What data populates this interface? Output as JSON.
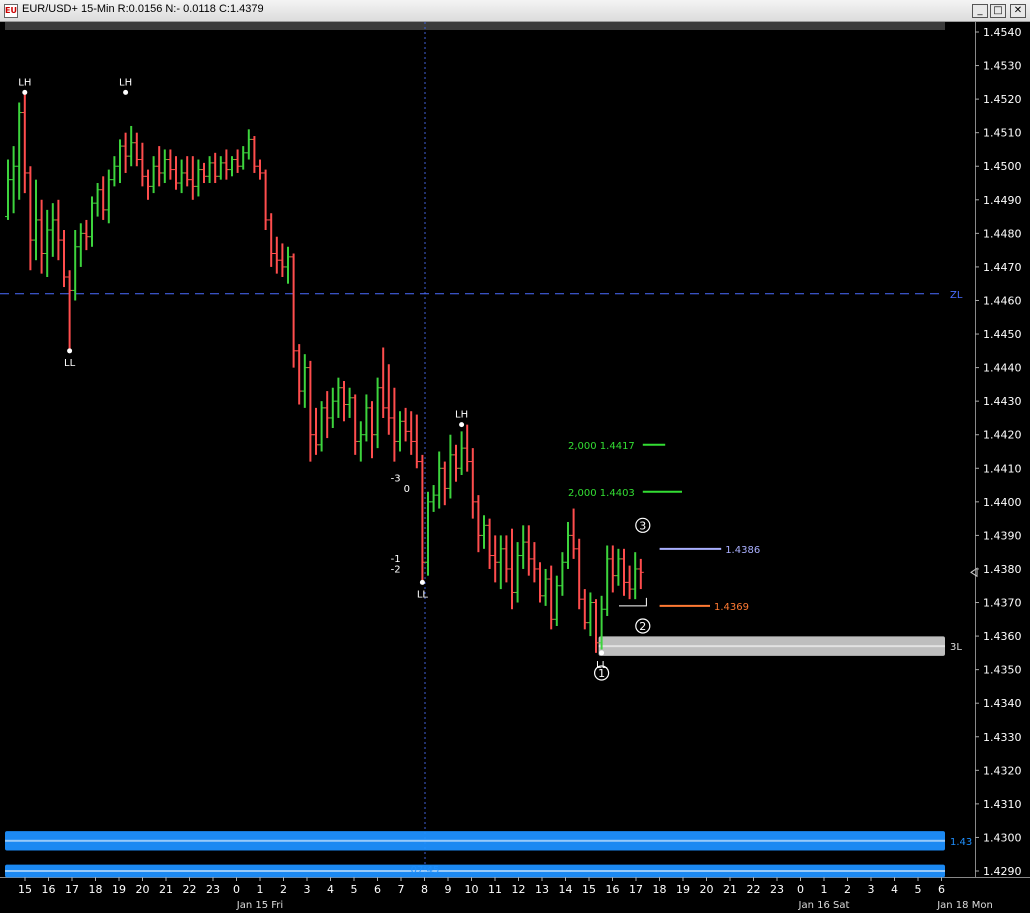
{
  "window": {
    "title": "EUR/USD+ 15-Min R:0.0156 N:- 0.0118 C:1.4379",
    "app_icon": "chart-window-icon",
    "controls": [
      {
        "name": "minimize-button",
        "icon": "minimize-icon",
        "glyph": "_"
      },
      {
        "name": "maximize-button",
        "icon": "maximize-icon",
        "glyph": "□"
      },
      {
        "name": "close-button",
        "icon": "close-icon",
        "glyph": "✕"
      }
    ]
  },
  "colors": {
    "background": "#000000",
    "up": "#3dd43d",
    "down": "#ff4d4d",
    "zl_line": "#4a6cff",
    "bar_blue": "#1e90ff",
    "target_green": "#33dd33",
    "target_blue": "#aab0ff",
    "target_orange": "#ff7a33",
    "axis_text": "#ffffff"
  },
  "chart_data": {
    "type": "ohlc",
    "symbol": "EUR/USD+",
    "interval": "15-Min",
    "ylim": [
      1.4287,
      1.4547
    ],
    "y_ticks": [
      "1.4540",
      "1.4530",
      "1.4520",
      "1.4510",
      "1.4500",
      "1.4490",
      "1.4480",
      "1.4470",
      "1.4460",
      "1.4450",
      "1.4440",
      "1.4430",
      "1.4420",
      "1.4410",
      "1.4400",
      "1.4390",
      "1.4380",
      "1.4370",
      "1.4360",
      "1.4350",
      "1.4340",
      "1.4330",
      "1.4320",
      "1.4310",
      "1.4300",
      "1.4290"
    ],
    "x_ticks": [
      "15",
      "16",
      "17",
      "18",
      "19",
      "20",
      "21",
      "22",
      "23",
      "0",
      "1",
      "2",
      "3",
      "4",
      "5",
      "6",
      "7",
      "8",
      "9",
      "10",
      "11",
      "12",
      "13",
      "14",
      "15",
      "16",
      "17",
      "18",
      "19",
      "20",
      "21",
      "22",
      "23",
      "0",
      "1",
      "2",
      "3",
      "4",
      "5",
      "6"
    ],
    "date_labels": [
      {
        "text": "Jan 15 Fri",
        "tick_index": 10
      },
      {
        "text": "Jan 16 Sat",
        "tick_index": 34
      },
      {
        "text": "Jan 18 Mon",
        "tick_index": 40
      }
    ],
    "bars": [
      {
        "open": 1.4485,
        "high": 1.4502,
        "low": 1.4484,
        "close": 1.4496
      },
      {
        "open": 1.4496,
        "high": 1.4506,
        "low": 1.4486,
        "close": 1.45
      },
      {
        "open": 1.45,
        "high": 1.4519,
        "low": 1.449,
        "close": 1.4516
      },
      {
        "open": 1.4516,
        "high": 1.4522,
        "low": 1.4492,
        "close": 1.4498
      },
      {
        "open": 1.4498,
        "high": 1.45,
        "low": 1.4469,
        "close": 1.4478
      },
      {
        "open": 1.4478,
        "high": 1.4496,
        "low": 1.4472,
        "close": 1.4484
      },
      {
        "open": 1.4484,
        "high": 1.449,
        "low": 1.4468,
        "close": 1.4474
      },
      {
        "open": 1.4474,
        "high": 1.4487,
        "low": 1.4467,
        "close": 1.4481
      },
      {
        "open": 1.4481,
        "high": 1.4489,
        "low": 1.4473,
        "close": 1.4484
      },
      {
        "open": 1.4484,
        "high": 1.449,
        "low": 1.4472,
        "close": 1.4478
      },
      {
        "open": 1.4478,
        "high": 1.4481,
        "low": 1.4464,
        "close": 1.4467
      },
      {
        "open": 1.4467,
        "high": 1.4469,
        "low": 1.4445,
        "close": 1.4463
      },
      {
        "open": 1.4463,
        "high": 1.4481,
        "low": 1.446,
        "close": 1.4476
      },
      {
        "open": 1.4476,
        "high": 1.4483,
        "low": 1.447,
        "close": 1.448
      },
      {
        "open": 1.448,
        "high": 1.4484,
        "low": 1.4475,
        "close": 1.4479
      },
      {
        "open": 1.4479,
        "high": 1.4491,
        "low": 1.4476,
        "close": 1.4489
      },
      {
        "open": 1.4489,
        "high": 1.4495,
        "low": 1.4485,
        "close": 1.4493
      },
      {
        "open": 1.4493,
        "high": 1.4497,
        "low": 1.4484,
        "close": 1.4487
      },
      {
        "open": 1.4487,
        "high": 1.4499,
        "low": 1.4483,
        "close": 1.4496
      },
      {
        "open": 1.4496,
        "high": 1.4503,
        "low": 1.4494,
        "close": 1.45
      },
      {
        "open": 1.45,
        "high": 1.4508,
        "low": 1.4495,
        "close": 1.4506
      },
      {
        "open": 1.4506,
        "high": 1.451,
        "low": 1.4498,
        "close": 1.4503
      },
      {
        "open": 1.4503,
        "high": 1.4512,
        "low": 1.45,
        "close": 1.4507
      },
      {
        "open": 1.4507,
        "high": 1.451,
        "low": 1.45,
        "close": 1.4502
      },
      {
        "open": 1.4502,
        "high": 1.4507,
        "low": 1.4494,
        "close": 1.4497
      },
      {
        "open": 1.4497,
        "high": 1.4499,
        "low": 1.449,
        "close": 1.4494
      },
      {
        "open": 1.4494,
        "high": 1.4503,
        "low": 1.4492,
        "close": 1.45
      },
      {
        "open": 1.45,
        "high": 1.4506,
        "low": 1.4494,
        "close": 1.4498
      },
      {
        "open": 1.4498,
        "high": 1.4505,
        "low": 1.4495,
        "close": 1.4502
      },
      {
        "open": 1.4502,
        "high": 1.4505,
        "low": 1.4496,
        "close": 1.4499
      },
      {
        "open": 1.4499,
        "high": 1.4503,
        "low": 1.4493,
        "close": 1.4495
      },
      {
        "open": 1.4495,
        "high": 1.4502,
        "low": 1.4492,
        "close": 1.4498
      },
      {
        "open": 1.4498,
        "high": 1.4503,
        "low": 1.4494,
        "close": 1.4496
      },
      {
        "open": 1.4496,
        "high": 1.4503,
        "low": 1.449,
        "close": 1.4494
      },
      {
        "open": 1.4494,
        "high": 1.4502,
        "low": 1.4491,
        "close": 1.4499
      },
      {
        "open": 1.4499,
        "high": 1.4501,
        "low": 1.4495,
        "close": 1.4497
      },
      {
        "open": 1.4497,
        "high": 1.4503,
        "low": 1.4495,
        "close": 1.4501
      },
      {
        "open": 1.4501,
        "high": 1.4504,
        "low": 1.4495,
        "close": 1.4497
      },
      {
        "open": 1.4497,
        "high": 1.4503,
        "low": 1.4496,
        "close": 1.4501
      },
      {
        "open": 1.4501,
        "high": 1.4505,
        "low": 1.4496,
        "close": 1.4499
      },
      {
        "open": 1.4499,
        "high": 1.4503,
        "low": 1.4497,
        "close": 1.4502
      },
      {
        "open": 1.4502,
        "high": 1.4505,
        "low": 1.4498,
        "close": 1.45
      },
      {
        "open": 1.45,
        "high": 1.4506,
        "low": 1.4499,
        "close": 1.4504
      },
      {
        "open": 1.4504,
        "high": 1.4511,
        "low": 1.4502,
        "close": 1.4508
      },
      {
        "open": 1.4508,
        "high": 1.4509,
        "low": 1.4498,
        "close": 1.45
      },
      {
        "open": 1.45,
        "high": 1.4502,
        "low": 1.4496,
        "close": 1.4498
      },
      {
        "open": 1.4498,
        "high": 1.4499,
        "low": 1.4481,
        "close": 1.4484
      },
      {
        "open": 1.4484,
        "high": 1.4486,
        "low": 1.447,
        "close": 1.4474
      },
      {
        "open": 1.4474,
        "high": 1.4479,
        "low": 1.4468,
        "close": 1.4472
      },
      {
        "open": 1.4472,
        "high": 1.4477,
        "low": 1.4467,
        "close": 1.447
      },
      {
        "open": 1.447,
        "high": 1.4476,
        "low": 1.4465,
        "close": 1.4473
      },
      {
        "open": 1.4473,
        "high": 1.4474,
        "low": 1.444,
        "close": 1.4445
      },
      {
        "open": 1.4445,
        "high": 1.4447,
        "low": 1.4429,
        "close": 1.4433
      },
      {
        "open": 1.4433,
        "high": 1.4444,
        "low": 1.4428,
        "close": 1.444
      },
      {
        "open": 1.444,
        "high": 1.4442,
        "low": 1.4412,
        "close": 1.442
      },
      {
        "open": 1.442,
        "high": 1.4428,
        "low": 1.4414,
        "close": 1.4417
      },
      {
        "open": 1.4417,
        "high": 1.443,
        "low": 1.4415,
        "close": 1.4428
      },
      {
        "open": 1.4428,
        "high": 1.4433,
        "low": 1.4419,
        "close": 1.4425
      },
      {
        "open": 1.4425,
        "high": 1.4434,
        "low": 1.4422,
        "close": 1.443
      },
      {
        "open": 1.443,
        "high": 1.4437,
        "low": 1.4425,
        "close": 1.4434
      },
      {
        "open": 1.4434,
        "high": 1.4436,
        "low": 1.4424,
        "close": 1.4429
      },
      {
        "open": 1.4429,
        "high": 1.4434,
        "low": 1.4425,
        "close": 1.4431
      },
      {
        "open": 1.4431,
        "high": 1.4432,
        "low": 1.4414,
        "close": 1.4418
      },
      {
        "open": 1.4418,
        "high": 1.4424,
        "low": 1.4412,
        "close": 1.442
      },
      {
        "open": 1.442,
        "high": 1.4432,
        "low": 1.4418,
        "close": 1.4428
      },
      {
        "open": 1.4428,
        "high": 1.443,
        "low": 1.4413,
        "close": 1.442
      },
      {
        "open": 1.442,
        "high": 1.4437,
        "low": 1.4416,
        "close": 1.4434
      },
      {
        "open": 1.4434,
        "high": 1.4446,
        "low": 1.4425,
        "close": 1.4428
      },
      {
        "open": 1.4428,
        "high": 1.4441,
        "low": 1.442,
        "close": 1.4425
      },
      {
        "open": 1.4425,
        "high": 1.4434,
        "low": 1.4412,
        "close": 1.4418
      },
      {
        "open": 1.4418,
        "high": 1.4427,
        "low": 1.4415,
        "close": 1.4424
      },
      {
        "open": 1.4424,
        "high": 1.4428,
        "low": 1.4418,
        "close": 1.4421
      },
      {
        "open": 1.4421,
        "high": 1.4427,
        "low": 1.4414,
        "close": 1.4418
      },
      {
        "open": 1.4418,
        "high": 1.4426,
        "low": 1.441,
        "close": 1.4412
      },
      {
        "open": 1.4412,
        "high": 1.4414,
        "low": 1.4376,
        "close": 1.4382
      },
      {
        "open": 1.4382,
        "high": 1.4403,
        "low": 1.4378,
        "close": 1.44
      },
      {
        "open": 1.44,
        "high": 1.4405,
        "low": 1.4397,
        "close": 1.4402
      },
      {
        "open": 1.4402,
        "high": 1.4415,
        "low": 1.4398,
        "close": 1.441
      },
      {
        "open": 1.441,
        "high": 1.4412,
        "low": 1.4399,
        "close": 1.4404
      },
      {
        "open": 1.4404,
        "high": 1.442,
        "low": 1.4401,
        "close": 1.4414
      },
      {
        "open": 1.4414,
        "high": 1.4417,
        "low": 1.4406,
        "close": 1.441
      },
      {
        "open": 1.441,
        "high": 1.4421,
        "low": 1.4408,
        "close": 1.4416
      },
      {
        "open": 1.4416,
        "high": 1.4423,
        "low": 1.4409,
        "close": 1.4412
      },
      {
        "open": 1.4412,
        "high": 1.4416,
        "low": 1.4395,
        "close": 1.44
      },
      {
        "open": 1.44,
        "high": 1.4402,
        "low": 1.4385,
        "close": 1.439
      },
      {
        "open": 1.439,
        "high": 1.4396,
        "low": 1.4386,
        "close": 1.4393
      },
      {
        "open": 1.4393,
        "high": 1.4395,
        "low": 1.438,
        "close": 1.4384
      },
      {
        "open": 1.4384,
        "high": 1.439,
        "low": 1.4376,
        "close": 1.4382
      },
      {
        "open": 1.4382,
        "high": 1.439,
        "low": 1.4374,
        "close": 1.4386
      },
      {
        "open": 1.4386,
        "high": 1.439,
        "low": 1.4376,
        "close": 1.438
      },
      {
        "open": 1.438,
        "high": 1.4392,
        "low": 1.4368,
        "close": 1.4373
      },
      {
        "open": 1.4373,
        "high": 1.4388,
        "low": 1.437,
        "close": 1.4384
      },
      {
        "open": 1.4384,
        "high": 1.4393,
        "low": 1.438,
        "close": 1.4388
      },
      {
        "open": 1.4388,
        "high": 1.4393,
        "low": 1.4378,
        "close": 1.4383
      },
      {
        "open": 1.4383,
        "high": 1.4388,
        "low": 1.4376,
        "close": 1.438
      },
      {
        "open": 1.438,
        "high": 1.4382,
        "low": 1.437,
        "close": 1.4372
      },
      {
        "open": 1.4372,
        "high": 1.438,
        "low": 1.4369,
        "close": 1.4377
      },
      {
        "open": 1.4377,
        "high": 1.4381,
        "low": 1.4362,
        "close": 1.4365
      },
      {
        "open": 1.4365,
        "high": 1.4378,
        "low": 1.4363,
        "close": 1.4375
      },
      {
        "open": 1.4375,
        "high": 1.4385,
        "low": 1.4372,
        "close": 1.4382
      },
      {
        "open": 1.4382,
        "high": 1.4394,
        "low": 1.438,
        "close": 1.439
      },
      {
        "open": 1.439,
        "high": 1.4398,
        "low": 1.4383,
        "close": 1.4386
      },
      {
        "open": 1.4386,
        "high": 1.4389,
        "low": 1.4368,
        "close": 1.4371
      },
      {
        "open": 1.4371,
        "high": 1.4374,
        "low": 1.4362,
        "close": 1.4364
      },
      {
        "open": 1.4364,
        "high": 1.4373,
        "low": 1.436,
        "close": 1.437
      },
      {
        "open": 1.437,
        "high": 1.4371,
        "low": 1.4355,
        "close": 1.4358
      },
      {
        "open": 1.4358,
        "high": 1.4372,
        "low": 1.4356,
        "close": 1.4368
      },
      {
        "open": 1.4368,
        "high": 1.4387,
        "low": 1.4366,
        "close": 1.4383
      },
      {
        "open": 1.4383,
        "high": 1.4387,
        "low": 1.4373,
        "close": 1.4378
      },
      {
        "open": 1.4378,
        "high": 1.4386,
        "low": 1.4375,
        "close": 1.4383
      },
      {
        "open": 1.4383,
        "high": 1.4386,
        "low": 1.4372,
        "close": 1.4376
      },
      {
        "open": 1.4376,
        "high": 1.4381,
        "low": 1.4371,
        "close": 1.4374
      },
      {
        "open": 1.4374,
        "high": 1.4385,
        "low": 1.4371,
        "close": 1.438
      },
      {
        "open": 1.438,
        "high": 1.4383,
        "low": 1.4374,
        "close": 1.4379
      }
    ],
    "swing_labels": [
      {
        "text": "LH",
        "bar": 3,
        "price": 1.4522,
        "side": "above"
      },
      {
        "text": "LH",
        "bar": 21,
        "price": 1.4522,
        "side": "above"
      },
      {
        "text": "LL",
        "bar": 11,
        "price": 1.4445,
        "side": "below"
      },
      {
        "text": "LH",
        "bar": 81,
        "price": 1.4423,
        "side": "above"
      },
      {
        "text": "LL",
        "bar": 74,
        "price": 1.4376,
        "side": "below"
      },
      {
        "text": "LL",
        "bar": 106,
        "price": 1.4355,
        "side": "below"
      }
    ],
    "wave_labels": [
      {
        "text": "1",
        "bar": 106,
        "price": 1.4349
      },
      {
        "text": "2",
        "bar": 113,
        "price": 1.4363
      },
      {
        "text": "3",
        "bar": 113,
        "price": 1.4393
      }
    ],
    "small_labels": [
      {
        "text": "-3",
        "bar": 71,
        "price": 1.4406
      },
      {
        "text": "0",
        "bar": 73,
        "price": 1.4403
      },
      {
        "text": "-1",
        "bar": 71,
        "price": 1.4382
      },
      {
        "text": "-2",
        "bar": 71,
        "price": 1.4379
      }
    ],
    "horizontal_lines": [
      {
        "label": "ZL",
        "price": 1.4462,
        "style": "dashed",
        "color": "zl_line"
      }
    ],
    "targets": [
      {
        "label": "2,000  1.4417",
        "price": 1.4417,
        "color": "target_green",
        "from_bar": 113,
        "to_bar": 117
      },
      {
        "label": "2,000  1.4403",
        "price": 1.4403,
        "color": "target_green",
        "from_bar": 113,
        "to_bar": 120
      },
      {
        "label": "1.4386",
        "price": 1.4386,
        "color": "target_blue",
        "from_bar": 116,
        "to_bar": 127
      },
      {
        "label": "1.4369",
        "price": 1.4369,
        "color": "target_orange",
        "from_bar": 116,
        "to_bar": 125
      }
    ],
    "zones": [
      {
        "label": "3L",
        "low": 1.4355,
        "high": 1.4359,
        "color": "#c8c8c8",
        "from_bar": 106
      },
      {
        "label": "1.43",
        "low": 1.4297,
        "high": 1.4301,
        "color": "bar_blue",
        "from_bar": 0
      },
      {
        "label": "",
        "low": 1.4289,
        "high": 1.4291,
        "color": "bar_blue",
        "from_bar": 0
      }
    ],
    "current_price": 1.4379,
    "time_marker": "07:45",
    "grid": false,
    "legend": "none"
  }
}
